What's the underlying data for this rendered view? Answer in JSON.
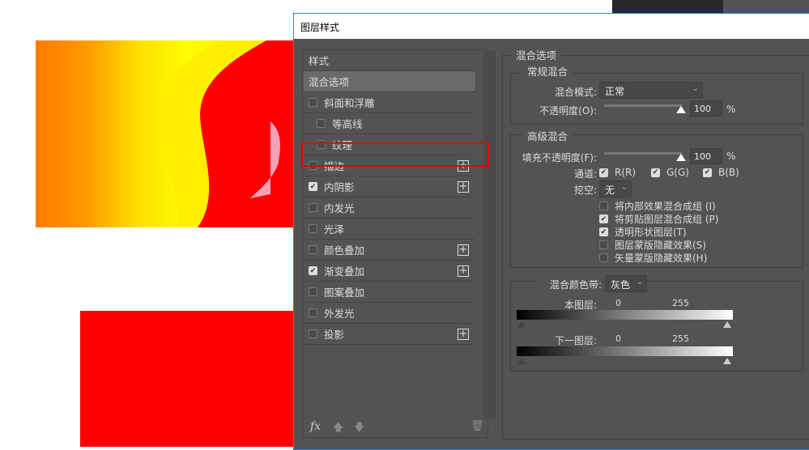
{
  "dialog": {
    "title": "图层样式"
  },
  "styles_list": {
    "header": "样式",
    "items": [
      {
        "label": "混合选项",
        "checked": null,
        "plus": false,
        "selected": true
      },
      {
        "label": "斜面和浮雕",
        "checked": false,
        "plus": false
      },
      {
        "label": "等高线",
        "checked": false,
        "plus": false,
        "indent": true
      },
      {
        "label": "纹理",
        "checked": false,
        "plus": false,
        "indent": true
      },
      {
        "label": "描边",
        "checked": false,
        "plus": true
      },
      {
        "label": "内阴影",
        "checked": true,
        "plus": true,
        "highlighted": true
      },
      {
        "label": "内发光",
        "checked": false,
        "plus": false
      },
      {
        "label": "光泽",
        "checked": false,
        "plus": false
      },
      {
        "label": "颜色叠加",
        "checked": false,
        "plus": true
      },
      {
        "label": "渐变叠加",
        "checked": true,
        "plus": true
      },
      {
        "label": "图案叠加",
        "checked": false,
        "plus": false
      },
      {
        "label": "外发光",
        "checked": false,
        "plus": false
      },
      {
        "label": "投影",
        "checked": false,
        "plus": true
      }
    ],
    "footer": {
      "fx": "fx"
    }
  },
  "blend": {
    "title": "混合选项",
    "general": {
      "title": "常规混合",
      "mode_label": "混合模式:",
      "mode_value": "正常",
      "opacity_label": "不透明度(O):",
      "opacity_value": "100",
      "opacity_unit": "%",
      "opacity": 100
    },
    "advanced": {
      "title": "高级混合",
      "fill_label": "填充不透明度(F):",
      "fill_value": "100",
      "fill_unit": "%",
      "fill": 100,
      "channels_label": "通道:",
      "channels": [
        {
          "label": "R(R)",
          "checked": true
        },
        {
          "label": "G(G)",
          "checked": true
        },
        {
          "label": "B(B)",
          "checked": true
        }
      ],
      "knockout_label": "挖空:",
      "knockout_value": "无",
      "options": [
        {
          "label": "将内部效果混合成组 (I)",
          "checked": false
        },
        {
          "label": "将剪贴图层混合成组 (P)",
          "checked": true
        },
        {
          "label": "透明形状图层(T)",
          "checked": true
        },
        {
          "label": "图层蒙版隐藏效果(S)",
          "checked": false
        },
        {
          "label": "矢量蒙版隐藏效果(H)",
          "checked": false
        }
      ]
    },
    "blend_if": {
      "label": "混合颜色带:",
      "value": "灰色",
      "this_layer": {
        "label": "本图层:",
        "min": "0",
        "max": "255"
      },
      "underlying": {
        "label": "下一图层:",
        "min": "0",
        "max": "255"
      }
    }
  },
  "colors": {
    "dialog_bg": "#535353",
    "highlight": "#ff0000",
    "accent": "#1e88e5"
  }
}
